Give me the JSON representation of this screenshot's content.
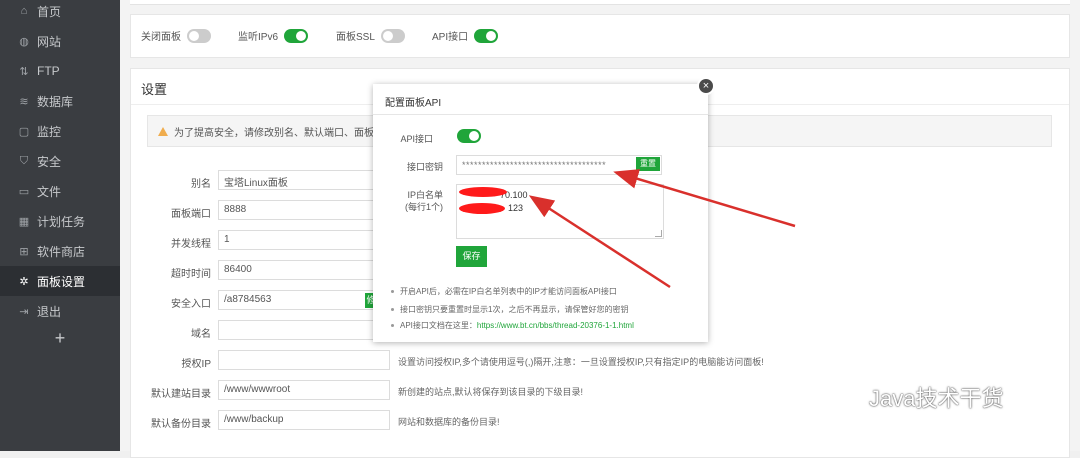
{
  "sidebar": {
    "items": [
      {
        "label": "首页",
        "icon": "home-icon",
        "glyph": "⌂"
      },
      {
        "label": "网站",
        "icon": "globe-icon",
        "glyph": "◍"
      },
      {
        "label": "FTP",
        "icon": "ftp-icon",
        "glyph": "⇅"
      },
      {
        "label": "数据库",
        "icon": "database-icon",
        "glyph": "≋"
      },
      {
        "label": "监控",
        "icon": "monitor-icon",
        "glyph": "▢"
      },
      {
        "label": "安全",
        "icon": "shield-icon",
        "glyph": "⛉"
      },
      {
        "label": "文件",
        "icon": "folder-icon",
        "glyph": "▭"
      },
      {
        "label": "计划任务",
        "icon": "calendar-icon",
        "glyph": "▦"
      },
      {
        "label": "软件商店",
        "icon": "apps-icon",
        "glyph": "⊞"
      },
      {
        "label": "面板设置",
        "icon": "gear-icon",
        "glyph": "✲"
      },
      {
        "label": "退出",
        "icon": "logout-icon",
        "glyph": "⇥"
      }
    ],
    "plus": "+"
  },
  "switches": {
    "close_panel": "关闭面板",
    "listen_ipv6": "监听IPv6",
    "panel_ssl": "面板SSL",
    "api": "API接口"
  },
  "settings": {
    "title": "设置",
    "warning": "为了提高安全，请修改别名、默认端口、面板用户和密码",
    "rows": [
      {
        "label": "别名",
        "value": "宝塔Linux面板"
      },
      {
        "label": "面板端口",
        "value": "8888"
      },
      {
        "label": "并发线程",
        "value": "1"
      },
      {
        "label": "超时时间",
        "value": "86400"
      },
      {
        "label": "安全入口",
        "value": "/a8784563"
      },
      {
        "label": "域名",
        "value": ""
      },
      {
        "label": "授权IP",
        "value": ""
      },
      {
        "label": "默认建站目录",
        "value": "/www/wwwroot"
      },
      {
        "label": "默认备份目录",
        "value": "/www/backup"
      }
    ],
    "hints": {
      "auth_ip": "设置访问授权IP,多个请使用逗号(,)隔开,注意：一旦设置授权IP,只有指定IP的电脑能访问面板!",
      "site_dir": "新创建的站点,默认将保存到该目录的下级目录!",
      "backup_dir": "网站和数据库的备份目录!"
    },
    "modify_button": "修改"
  },
  "modal": {
    "title": "配置面板API",
    "close": "×",
    "api_label": "API接口",
    "key_label": "接口密钥",
    "key_value": "************************************",
    "reset_button": "重置",
    "whitelist_label": "IP白名单",
    "whitelist_sub": "(每行1个)",
    "whitelist_line1": "70.100",
    "whitelist_line2": "123",
    "save_button": "保存",
    "notes": [
      "开启API后，必需在IP白名单列表中的IP才能访问面板API接口",
      "接口密钥只要重置时显示1次，之后不再显示，请保管好您的密钥"
    ],
    "doc_prefix": "API接口文档在这里：",
    "doc_link": "https://www.bt.cn/bbs/thread-20376-1-1.html"
  },
  "watermark": {
    "text": "Java技术干货",
    "icon": "wechat-icon"
  },
  "colors": {
    "accent": "#20a53a",
    "sidebar": "#3a3d41",
    "arrow": "#d9302c",
    "redact": "#ff1a1a"
  }
}
